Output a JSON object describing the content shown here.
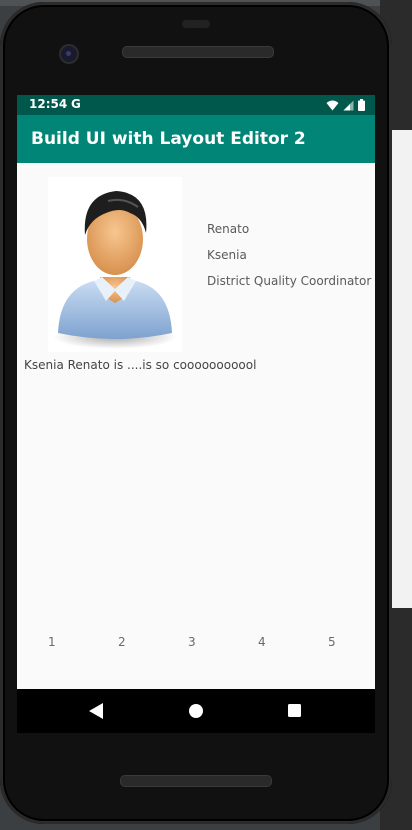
{
  "app": {
    "title": "Build UI with Layout Editor 2"
  },
  "status_bar": {
    "time": "12:54",
    "google_glyph": "G"
  },
  "profile": {
    "first_name": "Renato",
    "last_name": "Ksenia",
    "job_title": "District Quality Coordinator",
    "description": "Ksenia Renato is ....is so cooooooooool"
  },
  "number_row": [
    "1",
    "2",
    "3",
    "4",
    "5"
  ],
  "colors": {
    "status_bar": "#00574b",
    "app_bar": "#008577",
    "screen_bg": "#fafafa"
  },
  "icons": [
    "wifi-icon",
    "signal-icon",
    "battery-icon",
    "back-icon",
    "home-icon",
    "recents-icon",
    "avatar-icon"
  ]
}
